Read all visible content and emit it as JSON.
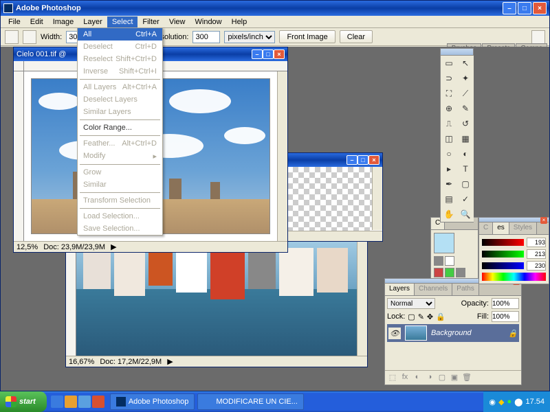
{
  "app": {
    "title": "Adobe Photoshop"
  },
  "menu": {
    "items": [
      "File",
      "Edit",
      "Image",
      "Layer",
      "Select",
      "Filter",
      "View",
      "Window",
      "Help"
    ],
    "activeIndex": 4
  },
  "options": {
    "widthLabel": "Width:",
    "widthVal": "30 cm",
    "heightVal": "",
    "resLabel": "Resolution:",
    "resVal": "300",
    "unit": "pixels/inch",
    "front": "Front Image",
    "clear": "Clear"
  },
  "tabwell": [
    "Brushes",
    "Presets",
    "Comps"
  ],
  "dropdown": [
    {
      "l": "All",
      "s": "Ctrl+A",
      "hl": true
    },
    {
      "l": "Deselect",
      "s": "Ctrl+D",
      "dis": true
    },
    {
      "l": "Reselect",
      "s": "Shift+Ctrl+D",
      "dis": true
    },
    {
      "l": "Inverse",
      "s": "Shift+Ctrl+I",
      "dis": true
    },
    {
      "sep": true
    },
    {
      "l": "All Layers",
      "s": "Alt+Ctrl+A",
      "dis": true
    },
    {
      "l": "Deselect Layers",
      "dis": true
    },
    {
      "l": "Similar Layers",
      "dis": true
    },
    {
      "sep": true
    },
    {
      "l": "Color Range..."
    },
    {
      "sep": true
    },
    {
      "l": "Feather...",
      "s": "Alt+Ctrl+D",
      "dis": true
    },
    {
      "l": "Modify",
      "arrow": true,
      "dis": true
    },
    {
      "sep": true
    },
    {
      "l": "Grow",
      "dis": true
    },
    {
      "l": "Similar",
      "dis": true
    },
    {
      "sep": true
    },
    {
      "l": "Transform Selection",
      "dis": true
    },
    {
      "sep": true
    },
    {
      "l": "Load Selection...",
      "dis": true
    },
    {
      "l": "Save Selection...",
      "dis": true
    }
  ],
  "doc1": {
    "title": "Cielo 001.tif @",
    "zoom": "12,5%",
    "status": "Doc: 23,9M/23,9M"
  },
  "doc2": {
    "zoom": "16,67%",
    "status": "Doc: 17,2M/22,9M"
  },
  "layers": {
    "tabs": [
      "Layers",
      "Channels",
      "Paths"
    ],
    "mode": "Normal",
    "opacityLbl": "Opacity:",
    "opacity": "100%",
    "lockLbl": "Lock:",
    "fillLbl": "Fill:",
    "fill": "100%",
    "layerName": "Background"
  },
  "color": {
    "tabs": [
      "C",
      "es",
      "Styles"
    ],
    "vals": [
      "193",
      "213",
      "230"
    ]
  },
  "taskbar": {
    "start": "start",
    "tasks": [
      "Adobe Photoshop",
      "MODIFICARE UN CIE..."
    ],
    "time": "17.54"
  }
}
